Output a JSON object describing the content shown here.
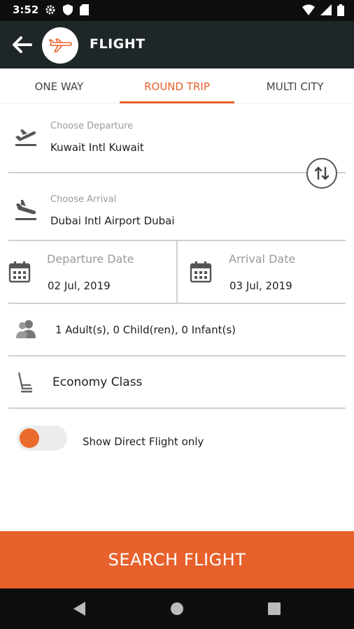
{
  "status_bar": {
    "time": "3:52",
    "left_icons": [
      "gear-icon",
      "shield-icon",
      "sd-card-icon"
    ],
    "right_icons": [
      "wifi-icon",
      "signal-icon",
      "battery-icon"
    ]
  },
  "app_bar": {
    "title": "FLIGHT",
    "back_icon": "arrow-left-icon",
    "logo_icon": "airplane-icon"
  },
  "tabs": [
    {
      "label": "ONE WAY",
      "active": false
    },
    {
      "label": "ROUND TRIP",
      "active": true
    },
    {
      "label": "MULTI CITY",
      "active": false
    }
  ],
  "departure": {
    "label": "Choose Departure",
    "value": "Kuwait Intl Kuwait",
    "icon": "flight-takeoff-icon"
  },
  "arrival": {
    "label": "Choose Arrival",
    "value": "Dubai Intl Airport Dubai",
    "icon": "flight-land-icon"
  },
  "swap_icon": "swap-vertical-icon",
  "dates": {
    "departure_label": "Departure Date",
    "departure_value": "02 Jul, 2019",
    "arrival_label": "Arrival Date",
    "arrival_value": "03 Jul, 2019",
    "icon": "calendar-icon"
  },
  "travellers": {
    "value": "1 Adult(s), 0 Child(ren), 0 Infant(s)",
    "icon": "people-icon"
  },
  "cabin_class": {
    "value": "Economy Class",
    "icon": "seat-icon"
  },
  "direct_flight": {
    "label": "Show Direct Flight only",
    "enabled": false
  },
  "search_button": "SEARCH FLIGHT",
  "nav_bar": [
    "back-triangle-icon",
    "home-circle-icon",
    "recents-square-icon"
  ],
  "colors": {
    "accent": "#e8612c",
    "app_bar": "#1e2628",
    "status_bar": "#0e0e0e"
  }
}
